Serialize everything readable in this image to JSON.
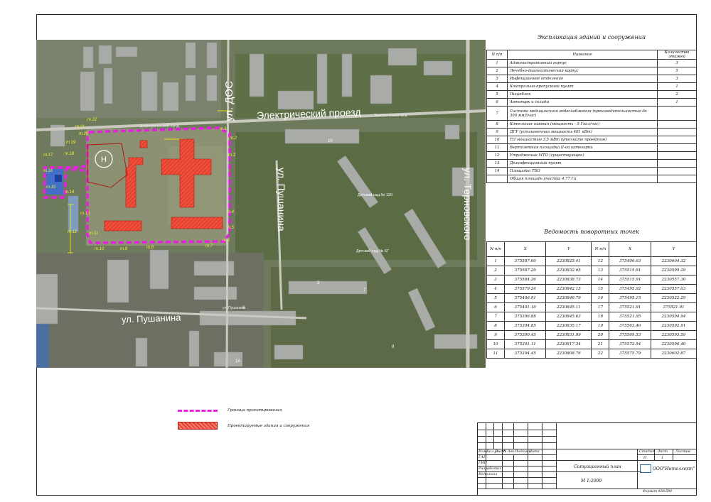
{
  "map": {
    "labels": {
      "dos": "ул. ДОС",
      "elektr_big": "Электрический проезд",
      "elektr_small": "Электрический пр-д",
      "elektr_small2": "Электрический пр-д",
      "pushanina_v": "ул. Пушанина",
      "pushanina_h": "ул. Пушанина",
      "pushanina_small": "ул. Пушанина",
      "ternovskogo": "ул. Терновского",
      "kindergarten_120": "Детский сад № 120",
      "kindergarten_67": "Детский сад № 67",
      "house_10": "10",
      "house_6": "6",
      "house_1a": "1А",
      "house_3": "3",
      "house_7": "7",
      "house_9": "9"
    },
    "points": [
      "т.1",
      "т.2",
      "т.3",
      "т.4",
      "т.5",
      "т.6",
      "т.7",
      "т.8",
      "т.9",
      "т.10",
      "т.11",
      "т.12",
      "т.13",
      "т.14",
      "т.15",
      "т.16",
      "т.17",
      "т.18",
      "т.19",
      "т.20",
      "т.21",
      "т.22"
    ],
    "helipad_letter": "Н"
  },
  "explication": {
    "title": "Экспликация зданий и сооружений",
    "headers": [
      "N п/п",
      "Название",
      "Количество этажей"
    ],
    "rows": [
      [
        "1",
        "Административный корпус",
        "3"
      ],
      [
        "2",
        "Лечебно-диагностический корпус",
        "5"
      ],
      [
        "3",
        "Инфекционное отделение",
        "3"
      ],
      [
        "4",
        "Контрольно-пропускной пункт",
        "1"
      ],
      [
        "5",
        "Пищеблок",
        "2"
      ],
      [
        "6",
        "Автопарк и склады",
        "1"
      ],
      [
        "7",
        "Система медицинского водоснабжения (производительностью до 300 мм3/час)",
        ""
      ],
      [
        "8",
        "Котельная газовая (мощность - 5 Гкал/час)",
        ""
      ],
      [
        "9",
        "ДГУ (установочная мощность 401 кВт)",
        ""
      ],
      [
        "10",
        "ТП мощностью 3,5 мВт (уточните проектом)",
        ""
      ],
      [
        "11",
        "Вертолетная площадка II-ой категории",
        ""
      ],
      [
        "12",
        "Утрадженые МТО (существующее)",
        ""
      ],
      [
        "13",
        "Дезинфекционный пункт",
        ""
      ],
      [
        "14",
        "Площадка ТБО",
        ""
      ],
      [
        "",
        "Общая площадь участка 4.77 Га",
        ""
      ]
    ]
  },
  "turning_points": {
    "title": "Ведомость поворотных точек",
    "headers": [
      "N п/п",
      "X",
      "Y",
      "N п/п",
      "X",
      "Y"
    ],
    "rows": [
      [
        "1",
        "375587.60",
        "2230825.41",
        "12",
        "375400.63",
        "2230604.32"
      ],
      [
        "2",
        "375587.29",
        "2230832.65",
        "13",
        "375515.91",
        "2230595.29"
      ],
      [
        "3",
        "375584.26",
        "2230838.73",
        "14",
        "375515.91",
        "2230557.30"
      ],
      [
        "4",
        "375579.24",
        "2230842.15",
        "15",
        "375495.92",
        "2230557.63"
      ],
      [
        "5",
        "375406.91",
        "2230846.79",
        "16",
        "375495.15",
        "2230522.29"
      ],
      [
        "6",
        "375401.10",
        "2230845.11",
        "17",
        "375521.91",
        "375521.91"
      ],
      [
        "7",
        "375396.88",
        "2230845.63",
        "18",
        "375521.95",
        "2230594.94"
      ],
      [
        "8",
        "375394.85",
        "2230835.17",
        "19",
        "375563.46",
        "2230592.91"
      ],
      [
        "9",
        "375390.45",
        "2230831.99",
        "20",
        "375569.53",
        "2230593.59"
      ],
      [
        "10",
        "375391.11",
        "2230817.34",
        "21",
        "375572.54",
        "2230596.40"
      ],
      [
        "11",
        "375394.45",
        "2230808.76",
        "22",
        "375575.79",
        "2230602.87"
      ]
    ]
  },
  "legend": {
    "boundary": "Граница проектирования",
    "buildings": "Проектируемые здания и сооружения"
  },
  "stamp": {
    "headers": [
      "Изм.",
      "Кол.уч",
      "Лист",
      "N док.",
      "Подпись",
      "Дата"
    ],
    "roles": [
      "ГАП",
      "ГИП",
      "Разработал",
      "Исполнил"
    ],
    "stage_h": "Стадия",
    "sheet_h": "Лист",
    "sheets_h": "Листов",
    "stage": "П",
    "sheet": "1",
    "sheets": "",
    "sheet_name": "Ситуационный план",
    "scale": "М 1:2000",
    "company": "ООО\"Интеллект\"",
    "format": "Формат 420х594"
  },
  "colors": {
    "boundary": "#e81fe0",
    "building": "#e23a2a",
    "road": "#c8c8c0",
    "dimension": "#e8e010"
  }
}
